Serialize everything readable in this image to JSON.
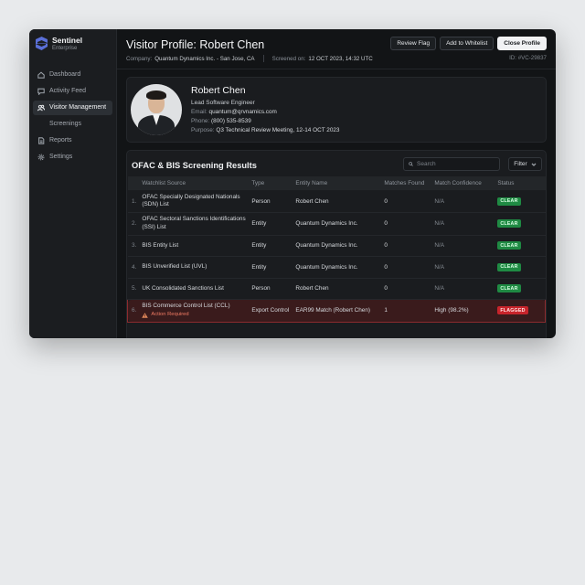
{
  "brand": {
    "name": "Sentinel",
    "subtitle": "Enterprise"
  },
  "sidebar": {
    "items": [
      {
        "label": "Dashboard",
        "icon": "home-icon"
      },
      {
        "label": "Activity Feed",
        "icon": "chat-icon"
      },
      {
        "label": "Visitor Management",
        "icon": "users-icon",
        "active": true
      },
      {
        "label": "Screenings",
        "icon": ""
      },
      {
        "label": "Reports",
        "icon": "document-icon"
      },
      {
        "label": "Settings",
        "icon": "gear-icon"
      }
    ]
  },
  "header": {
    "title": "Visitor Profile: Robert Chen",
    "company_label": "Company:",
    "company_value": "Quantum Dynamics Inc. - San Jose, CA",
    "screened_label": "Screened on:",
    "screened_value": "12 OCT 2023, 14:32 UTC",
    "record_id": "ID: #VC-29837",
    "buttons": {
      "review": "Review Flag",
      "whitelist": "Add to Whitelist",
      "close": "Close Profile"
    }
  },
  "profile": {
    "name": "Robert Chen",
    "role": "Lead Software Engineer",
    "email_label": "Email:",
    "email": "quantum@qrvnamics.com",
    "phone_label": "Phone:",
    "phone": "(800) 535-8539",
    "purpose_label": "Purpose:",
    "purpose": "Q3 Technical Review Meeting, 12-14 OCT 2023"
  },
  "results": {
    "title": "OFAC & BIS Screening Results",
    "search_placeholder": "Search",
    "filter_label": "Filter",
    "columns": [
      "Watchlist Source",
      "Type",
      "Entity Name",
      "Matches Found",
      "Match Confidence",
      "Status"
    ],
    "rows": [
      {
        "num": "1.",
        "source": "OFAC Specially Designated Nationals (SDN) List",
        "type": "Person",
        "entity": "Robert Chen",
        "matches": "0",
        "confidence": "N/A",
        "status": "CLEAR"
      },
      {
        "num": "2.",
        "source": "OFAC Sectoral Sanctions Identifications (SSI) List",
        "type": "Entity",
        "entity": "Quantum Dynamics Inc.",
        "matches": "0",
        "confidence": "N/A",
        "status": "CLEAR"
      },
      {
        "num": "3.",
        "source": "BIS Entity List",
        "type": "Entity",
        "entity": "Quantum Dynamics Inc.",
        "matches": "0",
        "confidence": "N/A",
        "status": "CLEAR"
      },
      {
        "num": "4.",
        "source": "BIS Unverified List (UVL)",
        "type": "Entity",
        "entity": "Quantum Dynamics Inc.",
        "matches": "0",
        "confidence": "N/A",
        "status": "CLEAR"
      },
      {
        "num": "5.",
        "source": "UK Consolidated Sanctions List",
        "type": "Person",
        "entity": "Robert Chen",
        "matches": "0",
        "confidence": "N/A",
        "status": "CLEAR"
      },
      {
        "num": "6.",
        "source": "BIS Commerce Control List (CCL)",
        "note": "Action Required",
        "type": "Export Control",
        "entity": "EAR99 Match (Robert Chen)",
        "matches": "1",
        "confidence": "High (98.2%)",
        "status": "FLAGGED"
      }
    ]
  },
  "colors": {
    "clear": "#1f8a43",
    "flagged": "#c7242b",
    "accent": "#5a6fd8"
  }
}
